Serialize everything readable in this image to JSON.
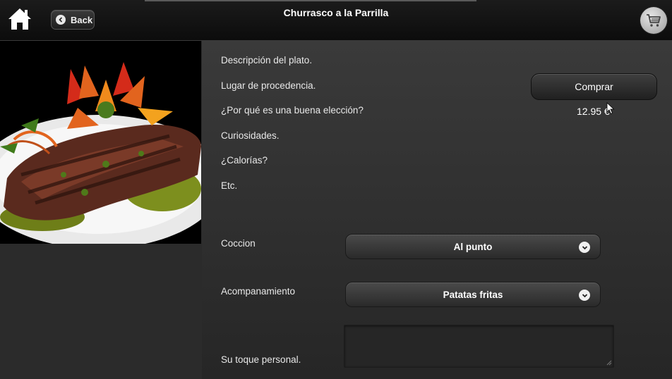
{
  "header": {
    "title": "Churrasco a la Parrilla",
    "back_label": "Back"
  },
  "icons": {
    "home": "home-icon",
    "back": "chevron-left-icon",
    "cart": "cart-icon"
  },
  "dish_image": "grilled-churrasco-photo",
  "description": {
    "lines": [
      "Descripción del plato.",
      "Lugar de procedencia.",
      "¿Por qué es una buena elección?",
      "Curiosidades.",
      "¿Calorías?",
      "Etc."
    ]
  },
  "purchase": {
    "buy_label": "Comprar",
    "price": "12.95 €"
  },
  "options": {
    "coccion_label": "Coccion",
    "coccion_value": "Al punto",
    "acompanamiento_label": "Acompanamiento",
    "acompanamiento_value": "Patatas fritas",
    "note_label": "Su toque personal.",
    "note_value": ""
  },
  "colors": {
    "topbar": "#111111",
    "panel": "#2f2f2f",
    "text": "#e8e8e8"
  }
}
